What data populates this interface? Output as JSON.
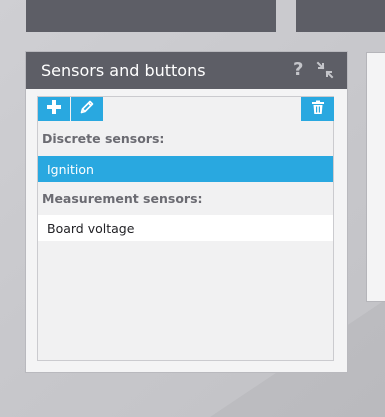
{
  "widget": {
    "title": "Sensors and buttons",
    "help_glyph": "?",
    "icons": {
      "help": "question-mark-icon",
      "collapse": "collapse-arrows-icon",
      "add": "plus-icon",
      "edit": "pencil-icon",
      "delete": "trash-icon"
    }
  },
  "sections": {
    "discrete_label": "Discrete sensors:",
    "discrete_items": [
      "Ignition"
    ],
    "measurement_label": "Measurement sensors:",
    "measurement_items": [
      "Board voltage"
    ]
  },
  "colors": {
    "header_bg": "#5d5e66",
    "accent": "#29a8e0",
    "panel_bg": "#f4f4f5",
    "backdrop": "#c9c9cd"
  }
}
